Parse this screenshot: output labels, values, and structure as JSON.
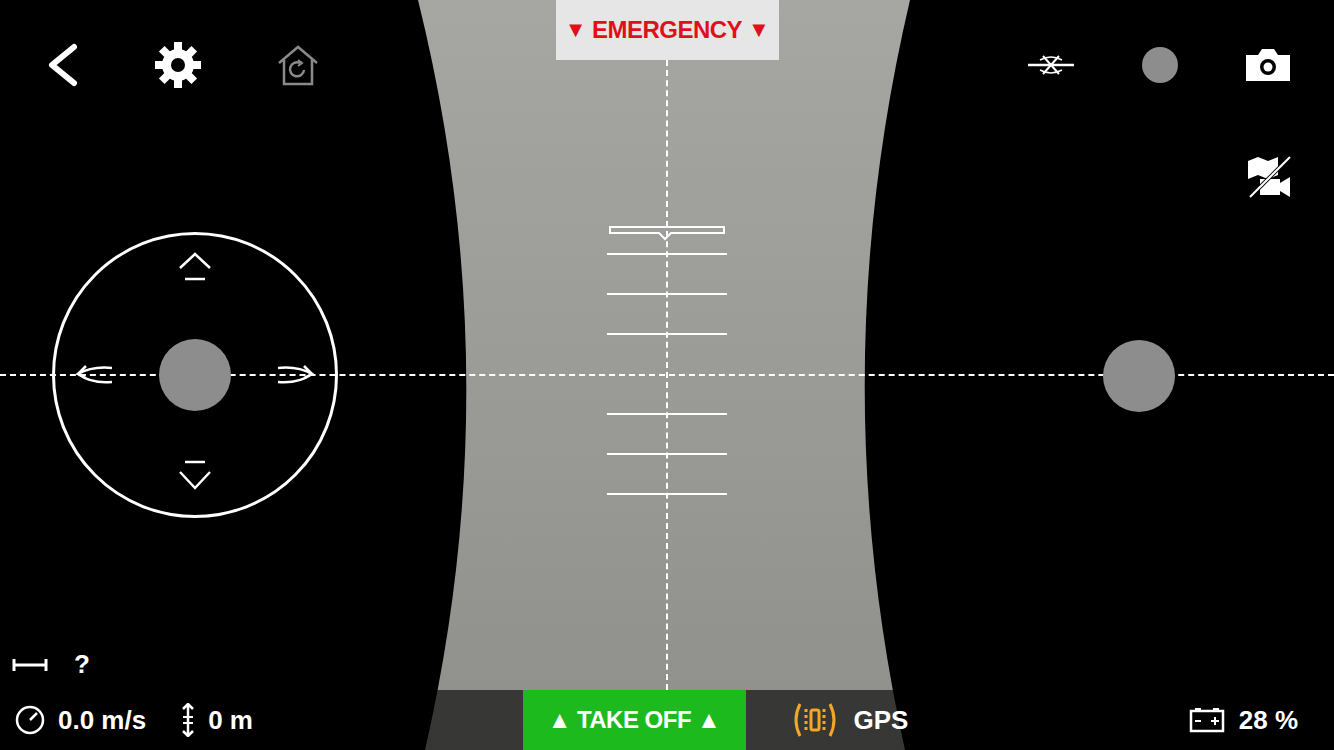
{
  "emergency": {
    "label": "EMERGENCY",
    "icon": "▼"
  },
  "recording": false,
  "range": {
    "value": "?"
  },
  "take_off": {
    "label": "TAKE OFF",
    "icon": "▲"
  },
  "status_bar": {
    "speed": "0.0 m/s",
    "altitude": "0 m",
    "gps": {
      "label": "GPS",
      "fixed": false
    },
    "battery": {
      "reading": "28 %"
    }
  }
}
